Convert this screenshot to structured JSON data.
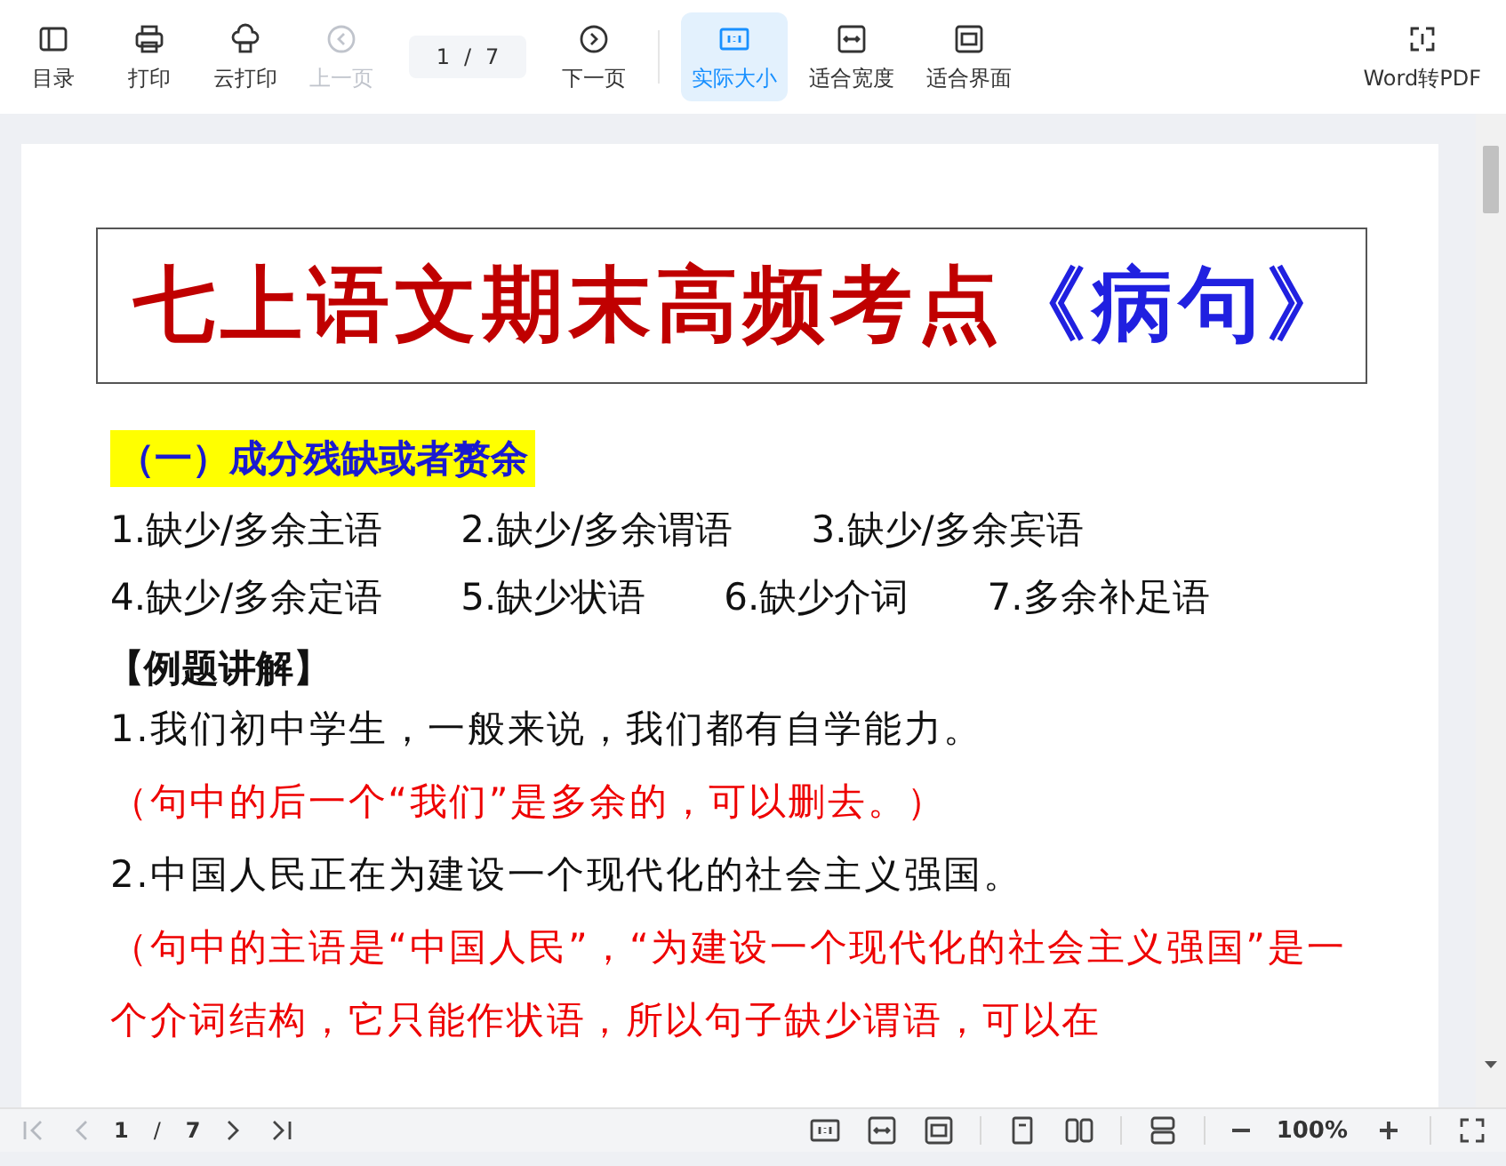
{
  "toolbar": {
    "items": [
      {
        "kind": "toc",
        "label": "目录",
        "disabled": false,
        "selected": false
      },
      {
        "kind": "print",
        "label": "打印",
        "disabled": false,
        "selected": false
      },
      {
        "kind": "cloud-print",
        "label": "云打印",
        "disabled": false,
        "selected": false
      },
      {
        "kind": "prev",
        "label": "上一页",
        "disabled": true,
        "selected": false
      },
      {
        "kind": "page",
        "current": "1",
        "separator": "/",
        "total": "7"
      },
      {
        "kind": "next",
        "label": "下一页",
        "disabled": false,
        "selected": false
      },
      {
        "kind": "actual-size",
        "label": "实际大小",
        "disabled": false,
        "selected": true
      },
      {
        "kind": "fit-width",
        "label": "适合宽度",
        "disabled": false,
        "selected": false
      },
      {
        "kind": "fit-page",
        "label": "适合界面",
        "disabled": false,
        "selected": false
      }
    ],
    "convert": {
      "label": "Word转PDF"
    }
  },
  "document": {
    "title": "七上语文期末高频考点",
    "title_accent": "《病句》",
    "section_heading": "（一）成分残缺或者赘余",
    "categories": [
      [
        "1.缺少/多余主语",
        "2.缺少/多余谓语",
        "3.缺少/多余宾语"
      ],
      [
        "4.缺少/多余定语",
        "5.缺少状语",
        "6.缺少介词",
        "7.多余补足语"
      ]
    ],
    "example_heading": "【例题讲解】",
    "lines": [
      {
        "kind": "sentence",
        "text": "1.我们初中学生，一般来说，我们都有自学能力。"
      },
      {
        "kind": "explanation",
        "text": "（句中的后一个“我们”是多余的，可以删去。）"
      },
      {
        "kind": "sentence",
        "text": "2.中国人民正在为建设一个现代化的社会主义强国。"
      },
      {
        "kind": "explanation",
        "text": "（句中的主语是“中国人民”，“为建设一个现代化的社会主义强国”是一个介词结构，它只能作状语，所以句子缺少谓语，可以在"
      }
    ]
  },
  "bottom_bar": {
    "current": "1",
    "separator": "/",
    "total": "7",
    "zoom": "100%"
  }
}
